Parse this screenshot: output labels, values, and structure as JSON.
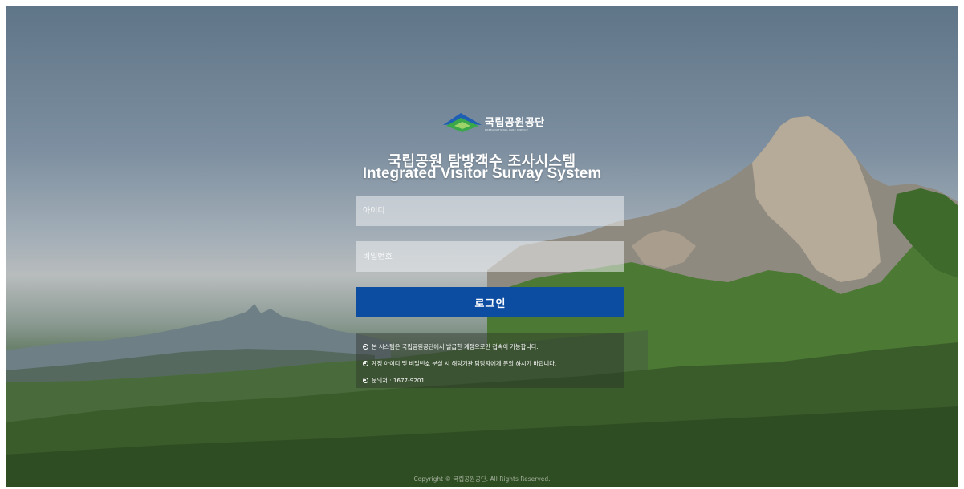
{
  "brand": {
    "name": "국립공원공단",
    "subtitle": "KOREA NATIONAL PARK SERVICE"
  },
  "title": {
    "korean": "국립공원 탐방객수 조사시스템",
    "english": "Integrated Visitor Survay System"
  },
  "login": {
    "id_placeholder": "아이디",
    "password_placeholder": "비밀번호",
    "submit_label": "로그인"
  },
  "notices": [
    "본 시스템은 국립공원공단에서 발급한 계정으로만 접속이 가능합니다.",
    "계정 아이디 및 비밀번호 분실 시 해당기관 담당자에게 문의 하시기 바랍니다.",
    "문의처 : 1677-9201"
  ],
  "footer": {
    "copyright": "Copyright © 국립공원공단. All Rights Reserved."
  },
  "colors": {
    "login_button": "#0c4da2",
    "logo_blue": "#1e5fb4",
    "logo_green": "#3aa84a"
  }
}
